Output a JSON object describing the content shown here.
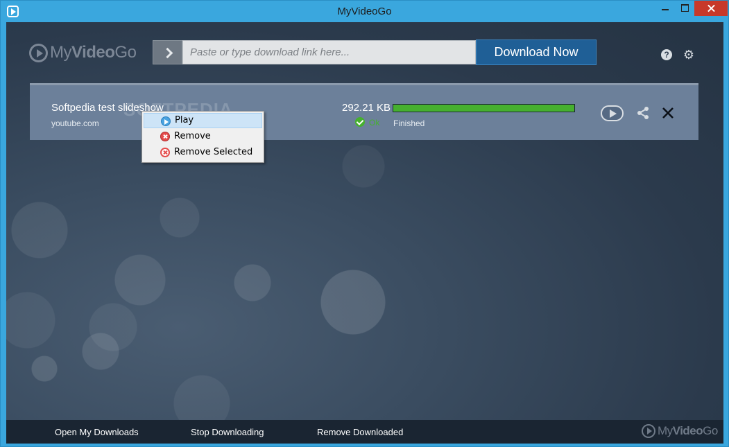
{
  "window": {
    "title": "MyVideoGo"
  },
  "header": {
    "logo_light": "My",
    "logo_bold": "Video",
    "logo_end": "Go",
    "url_placeholder": "Paste or type download link here...",
    "download_label": "Download Now",
    "help_symbol": "?",
    "settings_symbol": "⚙"
  },
  "download": {
    "title": "Softpedia test slideshow",
    "source": "youtube.com",
    "watermark": "SOFTPEDIA",
    "size": "292.21 KB",
    "progress_fraction": 1.0,
    "ok_label": "Ok",
    "status": "Finished"
  },
  "context_menu": {
    "items": [
      {
        "label": "Play",
        "icon": "play-icon",
        "highlighted": true
      },
      {
        "label": "Remove",
        "icon": "remove-icon",
        "highlighted": false
      },
      {
        "label": "Remove Selected",
        "icon": "remove-selected-icon",
        "highlighted": false
      }
    ]
  },
  "footer": {
    "open_downloads": "Open My Downloads",
    "stop_downloading": "Stop Downloading",
    "remove_downloaded": "Remove Downloaded",
    "logo_light": "My",
    "logo_bold": "Video",
    "logo_end": "Go"
  },
  "colors": {
    "accent": "#3aa7de",
    "download_button": "#1f5f96",
    "progress": "#46b02f",
    "footer": "#1a2532"
  }
}
